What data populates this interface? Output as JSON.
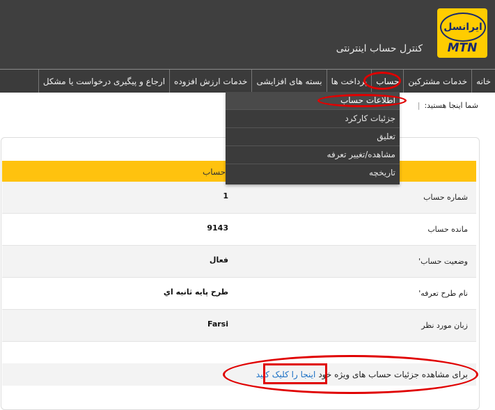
{
  "header": {
    "logo_text": "ایرانسل",
    "logo_brand": "MTN",
    "site_title": "کنترل حساب اینترنتی"
  },
  "nav": {
    "items": [
      {
        "label": "خانه"
      },
      {
        "label": "خدمات مشترکین"
      },
      {
        "label": "حساب"
      },
      {
        "label": "پرداخت ها"
      },
      {
        "label": "بسته های افزایشی"
      },
      {
        "label": "خدمات ارزش افزوده"
      },
      {
        "label": "ارجاع و پیگیری درخواست یا مشکل"
      }
    ]
  },
  "dropdown": {
    "items": [
      {
        "label": "اطلاعات حساب"
      },
      {
        "label": "جزئیات کارکرد"
      },
      {
        "label": "تعلیق"
      },
      {
        "label": "مشاهده/تغییر تعرفه"
      },
      {
        "label": "تاریخچه"
      }
    ]
  },
  "breadcrumb": {
    "prefix": "شما اینجا هستید:",
    "separator": "|"
  },
  "table": {
    "header_fragment": "حساب",
    "rows": [
      {
        "label": "شماره حساب",
        "value": "1"
      },
      {
        "label": "مانده حساب",
        "value": "9143"
      },
      {
        "label": "وضعیت حساب'",
        "value": "فعال"
      },
      {
        "label": "نام طرح تعرفه'",
        "value": "طرح پایه ثانیه اي"
      },
      {
        "label": "زبان مورد نظر",
        "value": "Farsi"
      }
    ]
  },
  "footer_link": {
    "text": "برای مشاهده جزئیات حساب های ویژه خود",
    "link": "اینجا را کلیک کنید"
  },
  "colors": {
    "header_bg": "#3f3f3f",
    "accent_yellow": "#ffc20e",
    "link": "#1a6fc4",
    "annotation_red": "#e00000"
  }
}
